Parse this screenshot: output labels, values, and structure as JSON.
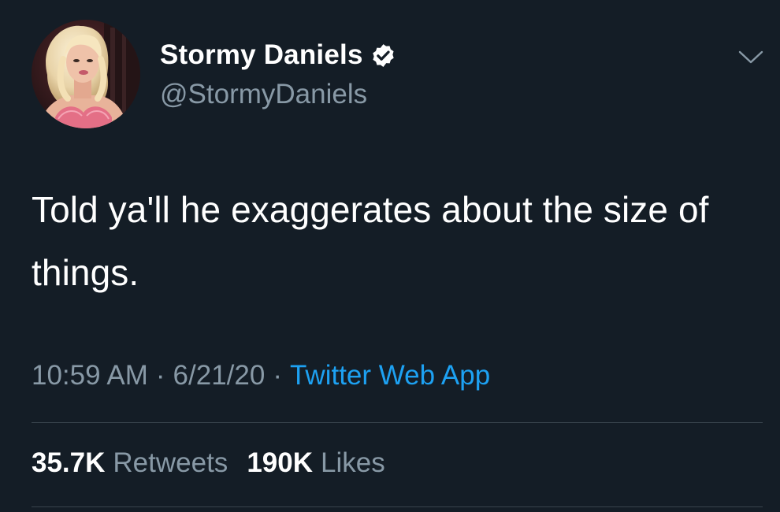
{
  "colors": {
    "background": "#141d26",
    "primary_text": "#ffffff",
    "secondary_text": "#8899a6",
    "link": "#1da1f2",
    "divider": "#38444d"
  },
  "author": {
    "display_name": "Stormy Daniels",
    "handle": "@StormyDaniels",
    "verified": true,
    "verified_icon": "verified-badge-icon",
    "avatar_icon": "profile-photo"
  },
  "menu": {
    "icon": "chevron-down-icon"
  },
  "tweet": {
    "text": "Told ya'll he exaggerates about the size of things."
  },
  "meta": {
    "time": "10:59 AM",
    "separator": "·",
    "date": "6/21/20",
    "source": "Twitter Web App"
  },
  "stats": {
    "retweets_count": "35.7K",
    "retweets_label": "Retweets",
    "likes_count": "190K",
    "likes_label": "Likes"
  }
}
